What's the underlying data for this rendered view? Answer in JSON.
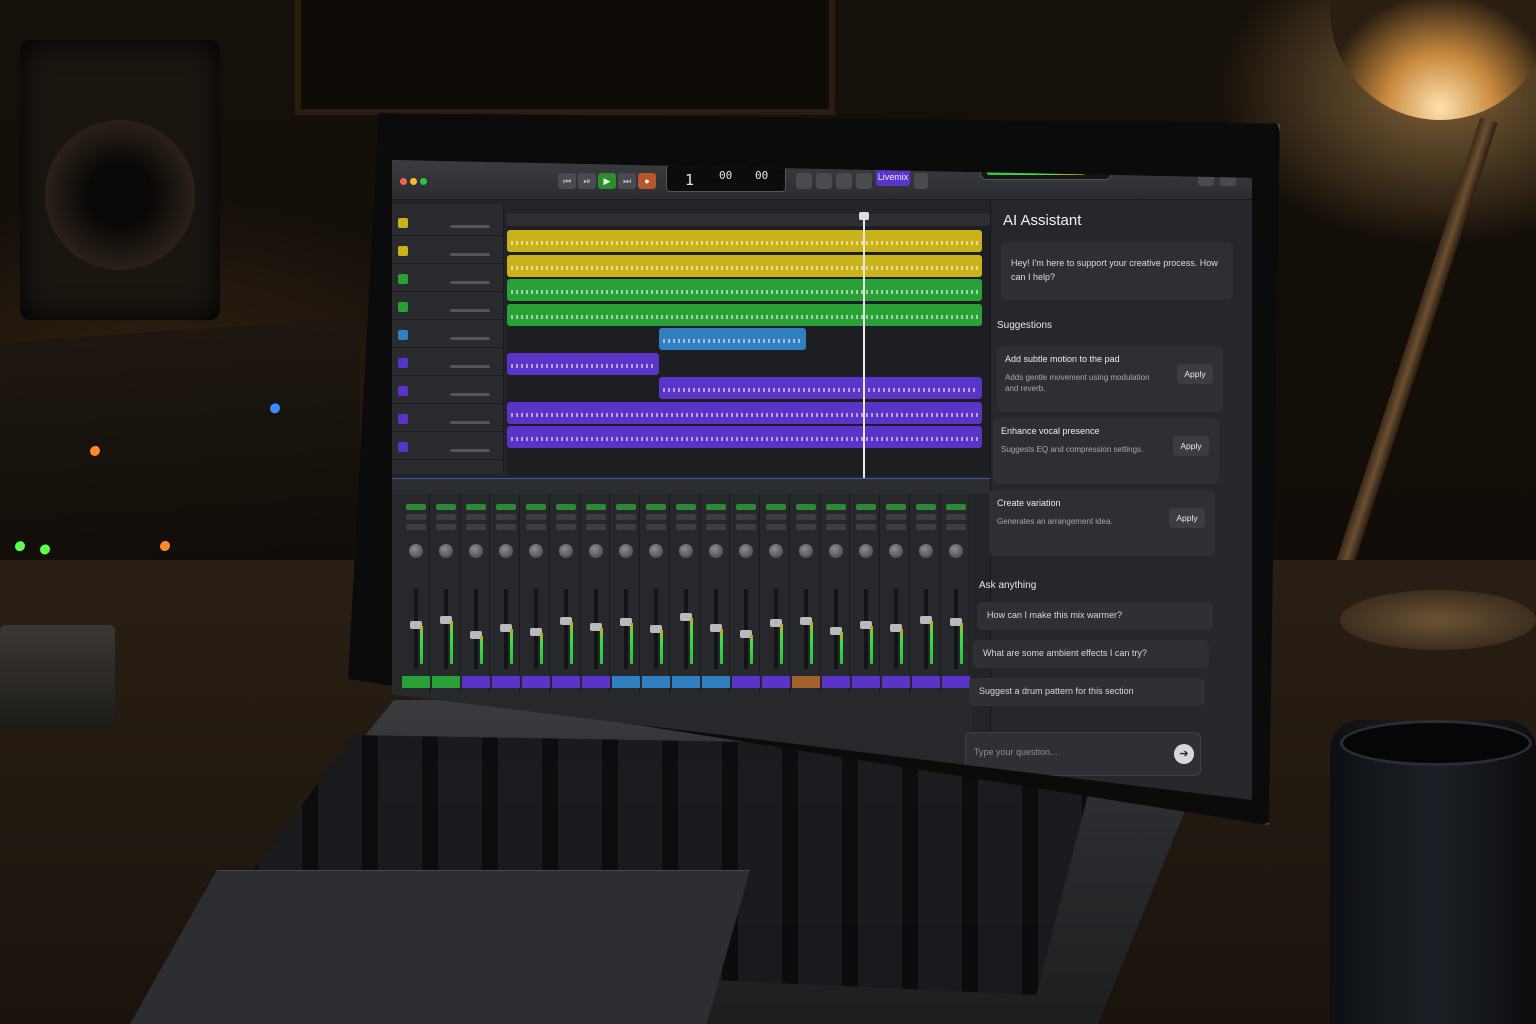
{
  "toolbar": {
    "transport": [
      "⏮",
      "⏯",
      "▶",
      "⏭",
      "●"
    ],
    "lcd_bar": "1",
    "lcd_beat": "00",
    "lcd_tempo": "00",
    "mode_label": "Livemix"
  },
  "tracks": [
    {
      "color": "#c9b21a"
    },
    {
      "color": "#c9b21a"
    },
    {
      "color": "#2aa136"
    },
    {
      "color": "#2aa136"
    },
    {
      "color": "#2f7fc1"
    },
    {
      "color": "#5a33c9"
    },
    {
      "color": "#5a33c9"
    },
    {
      "color": "#5a33c9"
    },
    {
      "color": "#5a33c9"
    }
  ],
  "regions": [
    {
      "track": 0,
      "start": 0.0,
      "end": 1.0,
      "color": "#c9b21a"
    },
    {
      "track": 1,
      "start": 0.0,
      "end": 1.0,
      "color": "#c9b21a"
    },
    {
      "track": 2,
      "start": 0.0,
      "end": 1.0,
      "color": "#2aa136"
    },
    {
      "track": 3,
      "start": 0.0,
      "end": 1.0,
      "color": "#2aa136"
    },
    {
      "track": 4,
      "start": 0.32,
      "end": 0.63,
      "color": "#2f7fc1"
    },
    {
      "track": 5,
      "start": 0.0,
      "end": 0.32,
      "color": "#5a33c9"
    },
    {
      "track": 6,
      "start": 0.32,
      "end": 1.0,
      "color": "#5a33c9"
    },
    {
      "track": 7,
      "start": 0.0,
      "end": 1.0,
      "color": "#5a33c9"
    },
    {
      "track": 8,
      "start": 0.0,
      "end": 1.0,
      "color": "#5a33c9"
    }
  ],
  "playhead_position": 0.75,
  "mixer": {
    "strips": [
      {
        "color": "#2aa136",
        "level": 0.55
      },
      {
        "color": "#2aa136",
        "level": 0.62
      },
      {
        "color": "#5a33c9",
        "level": 0.4
      },
      {
        "color": "#5a33c9",
        "level": 0.5
      },
      {
        "color": "#5a33c9",
        "level": 0.45
      },
      {
        "color": "#5a33c9",
        "level": 0.6
      },
      {
        "color": "#5a33c9",
        "level": 0.52
      },
      {
        "color": "#2f7fc1",
        "level": 0.58
      },
      {
        "color": "#2f7fc1",
        "level": 0.48
      },
      {
        "color": "#2f7fc1",
        "level": 0.66
      },
      {
        "color": "#2f7fc1",
        "level": 0.5
      },
      {
        "color": "#5a33c9",
        "level": 0.42
      },
      {
        "color": "#5a33c9",
        "level": 0.57
      },
      {
        "color": "#a0622a",
        "level": 0.6
      },
      {
        "color": "#5a33c9",
        "level": 0.46
      },
      {
        "color": "#5a33c9",
        "level": 0.55
      },
      {
        "color": "#5a33c9",
        "level": 0.5
      },
      {
        "color": "#5a33c9",
        "level": 0.62
      },
      {
        "color": "#5a33c9",
        "level": 0.58
      }
    ]
  },
  "ai": {
    "title": "AI Assistant",
    "greeting": "Hey! I'm here to support your creative process. How can I help?",
    "suggestions_heading": "Suggestions",
    "suggestions": [
      {
        "title": "Add subtle motion to the pad",
        "desc": "Adds gentle movement using modulation and reverb.",
        "action": "Apply"
      },
      {
        "title": "Enhance vocal presence",
        "desc": "Suggests EQ and compression settings.",
        "action": "Apply"
      },
      {
        "title": "Create variation",
        "desc": "Generates an arrangement idea.",
        "action": "Apply"
      }
    ],
    "ask_heading": "Ask anything",
    "prompts": [
      "How can I make this mix warmer?",
      "What are some ambient effects I can try?",
      "Suggest a drum pattern for this section"
    ],
    "input_placeholder": "Type your question...",
    "send_icon": "arrow-right-icon"
  },
  "colors": {
    "accent": "#5a33c9",
    "play": "#2e8b2e",
    "meter": "#3de04b"
  }
}
